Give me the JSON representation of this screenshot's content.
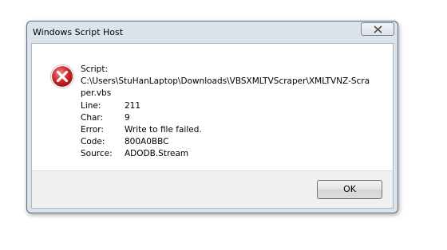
{
  "window": {
    "title": "Windows Script Host",
    "close_icon": "close-icon"
  },
  "dialog": {
    "icon": "error-icon",
    "script_label": "Script:",
    "script_path_line1": "C:\\Users\\StuHanLaptop\\Downloads\\VBSXMLTVScraper\\XMLTVNZ-Scra",
    "script_path_line2": "per.vbs",
    "fields": [
      {
        "label": "Line:",
        "value": "211"
      },
      {
        "label": "Char:",
        "value": "9"
      },
      {
        "label": "Error:",
        "value": "Write to file failed."
      },
      {
        "label": "Code:",
        "value": "800A0BBC"
      },
      {
        "label": "Source:",
        "value": "ADODB.Stream"
      }
    ],
    "ok_label": "OK"
  },
  "colors": {
    "error_red": "#d42a2a",
    "frame": "#dbe3ed"
  }
}
